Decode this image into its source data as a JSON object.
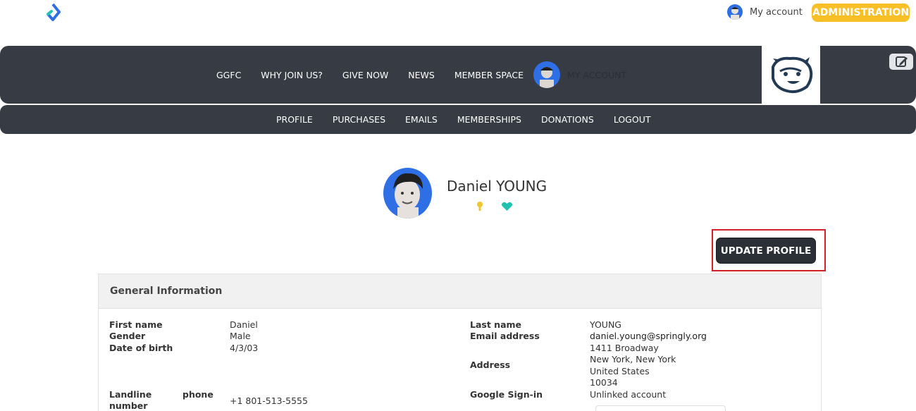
{
  "topbar": {
    "my_account": "My account",
    "administration": "ADMINISTRATION"
  },
  "nav": {
    "items": [
      "GGFC",
      "WHY JOIN US?",
      "GIVE NOW",
      "NEWS",
      "MEMBER SPACE"
    ],
    "my_account": "MY ACCOUNT"
  },
  "subnav": {
    "items": [
      "PROFILE",
      "PURCHASES",
      "EMAILS",
      "MEMBERSHIPS",
      "DONATIONS",
      "LOGOUT"
    ]
  },
  "profile": {
    "name": "Daniel YOUNG",
    "update_button": "UPDATE PROFILE"
  },
  "general": {
    "title": "General Information",
    "left": {
      "first_name_label": "First name",
      "first_name": "Daniel",
      "gender_label": "Gender",
      "gender": "Male",
      "dob_label": "Date of birth",
      "dob": "4/3/03",
      "landline_label_1": "Landline",
      "landline_label_2": "phone",
      "landline_label_3": "number",
      "landline": "+1 801-513-5555"
    },
    "right": {
      "last_name_label": "Last name",
      "last_name": "YOUNG",
      "email_label": "Email address",
      "email": "daniel.young@springly.org",
      "address_label": "Address",
      "address_lines": [
        "1411 Broadway",
        "New York, New York",
        "United States",
        "10034"
      ],
      "google_label": "Google Sign-in",
      "google": "Unlinked account"
    }
  },
  "colors": {
    "nav_bg": "#363b44",
    "admin": "#f9bf27",
    "highlight": "#d5202a",
    "button_dark": "#2b2f36"
  }
}
